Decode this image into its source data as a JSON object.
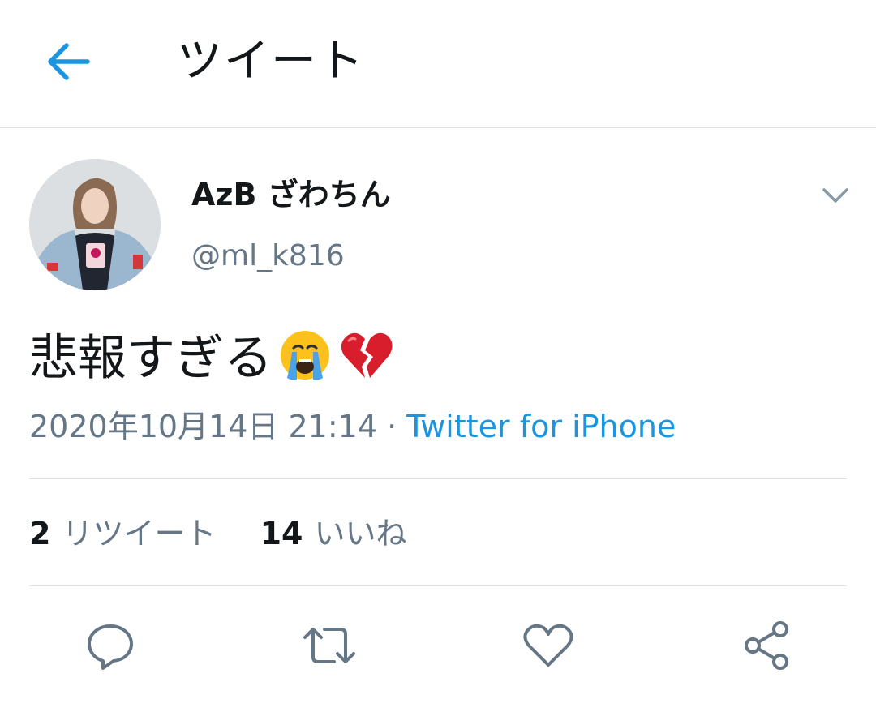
{
  "header": {
    "title": "ツイート",
    "back_icon": "arrow-left-icon"
  },
  "tweet": {
    "user": {
      "display_name": "AzB ざわちん",
      "handle": "@ml_k816",
      "avatar": "avatar-image"
    },
    "text": "悲報すぎる",
    "emojis": [
      "loudly-crying-face",
      "broken-heart"
    ],
    "timestamp": "2020年10月14日 21:14",
    "separator": "·",
    "source": "Twitter for iPhone"
  },
  "stats": {
    "retweets_count": "2",
    "retweets_label": "リツイート",
    "likes_count": "14",
    "likes_label": "いいね"
  },
  "actions": [
    "reply-icon",
    "retweet-icon",
    "like-icon",
    "share-icon"
  ],
  "colors": {
    "accent": "#1b95e0",
    "text": "#14171a",
    "secondary": "#657786",
    "divider": "#dfe3e6",
    "icon": "#657786"
  }
}
